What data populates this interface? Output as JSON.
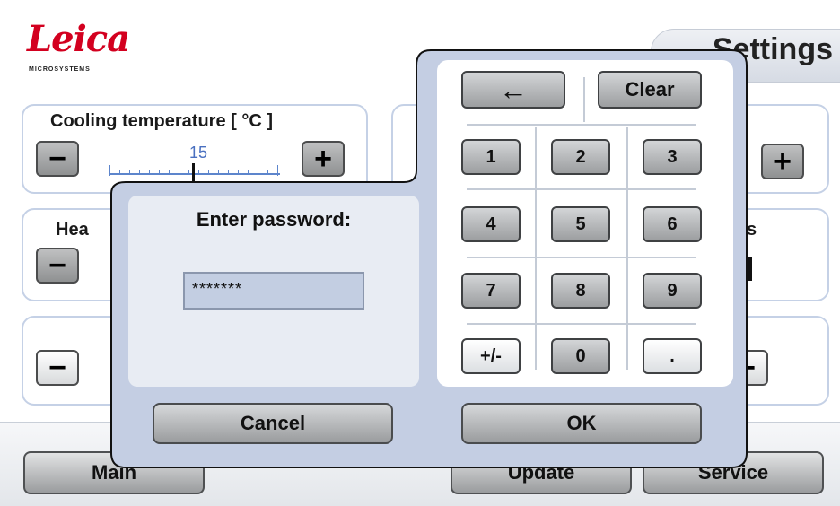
{
  "app": {
    "brand": "Leica",
    "brand_sub": "MICROSYSTEMS",
    "title": "Settings"
  },
  "panels": {
    "cooling": {
      "label": "Cooling temperature [  °C ]",
      "value": "15"
    },
    "heating": {
      "label_partial": "Hea"
    },
    "right_partial": {
      "label_partial": "s"
    }
  },
  "controls": {
    "minus": "−",
    "plus": "+"
  },
  "nav": {
    "main": "Main",
    "update": "Update",
    "service": "Service"
  },
  "dialog": {
    "prompt": "Enter password:",
    "password_value": "*******",
    "keys": {
      "backspace": "←",
      "clear": "Clear",
      "row1": [
        "1",
        "2",
        "3"
      ],
      "row2": [
        "4",
        "5",
        "6"
      ],
      "row3": [
        "7",
        "8",
        "9"
      ],
      "row4": [
        "+/-",
        "0",
        "."
      ]
    },
    "cancel": "Cancel",
    "ok": "OK"
  },
  "colors": {
    "brand_red": "#d3001f",
    "panel_border": "#c5d1e6",
    "dialog_bg": "#c4cee3",
    "value_blue": "#4a70c0"
  }
}
